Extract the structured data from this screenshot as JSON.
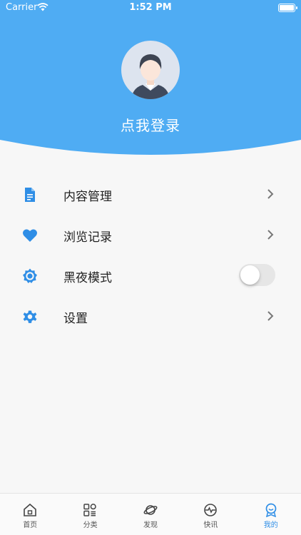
{
  "status_bar": {
    "carrier": "Carrier",
    "time": "1:52 PM"
  },
  "profile": {
    "login_label": "点我登录"
  },
  "menu": {
    "items": [
      {
        "label": "内容管理",
        "icon": "document-icon",
        "accessory": "chevron"
      },
      {
        "label": "浏览记录",
        "icon": "heart-icon",
        "accessory": "chevron"
      },
      {
        "label": "黑夜模式",
        "icon": "sun-gear-icon",
        "accessory": "toggle",
        "toggle_on": false
      },
      {
        "label": "设置",
        "icon": "gear-icon",
        "accessory": "chevron"
      }
    ]
  },
  "tabbar": {
    "tabs": [
      {
        "label": "首页",
        "icon": "home-icon"
      },
      {
        "label": "分类",
        "icon": "grid-icon"
      },
      {
        "label": "发现",
        "icon": "planet-icon"
      },
      {
        "label": "快讯",
        "icon": "pulse-clock-icon"
      },
      {
        "label": "我的",
        "icon": "badge-icon",
        "active": true
      }
    ]
  },
  "colors": {
    "accent": "#4facf3",
    "active_tab": "#2f8ee6",
    "icon_blue": "#2f8ee6"
  }
}
